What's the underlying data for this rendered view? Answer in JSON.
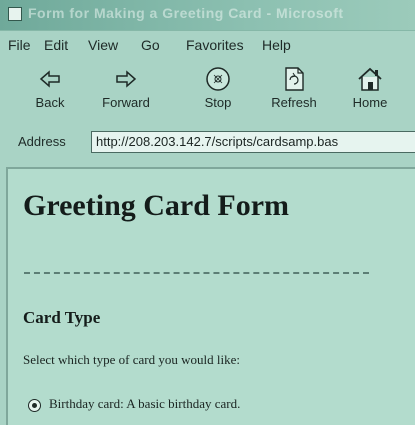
{
  "window": {
    "title": "Form for Making a Greeting Card - Microsoft"
  },
  "menu": [
    "File",
    "Edit",
    "View",
    "Go",
    "Favorites",
    "Help"
  ],
  "toolbar": {
    "buttons": [
      {
        "label": "Back",
        "icon": "back-arrow-icon"
      },
      {
        "label": "Forward",
        "icon": "forward-arrow-icon"
      },
      {
        "label": "Stop",
        "icon": "stop-icon"
      },
      {
        "label": "Refresh",
        "icon": "refresh-icon"
      },
      {
        "label": "Home",
        "icon": "home-icon"
      }
    ]
  },
  "address": {
    "label": "Address",
    "url": "http://208.203.142.7/scripts/cardsamp.bas"
  },
  "page": {
    "title": "Greeting Card Form",
    "section_heading": "Card Type",
    "prompt": "Select which type of card you would like:",
    "option": {
      "label": "Birthday card: A basic birthday card.",
      "selected": true
    }
  },
  "colors": {
    "background": "#a9d3c5",
    "text": "#141c1a"
  }
}
